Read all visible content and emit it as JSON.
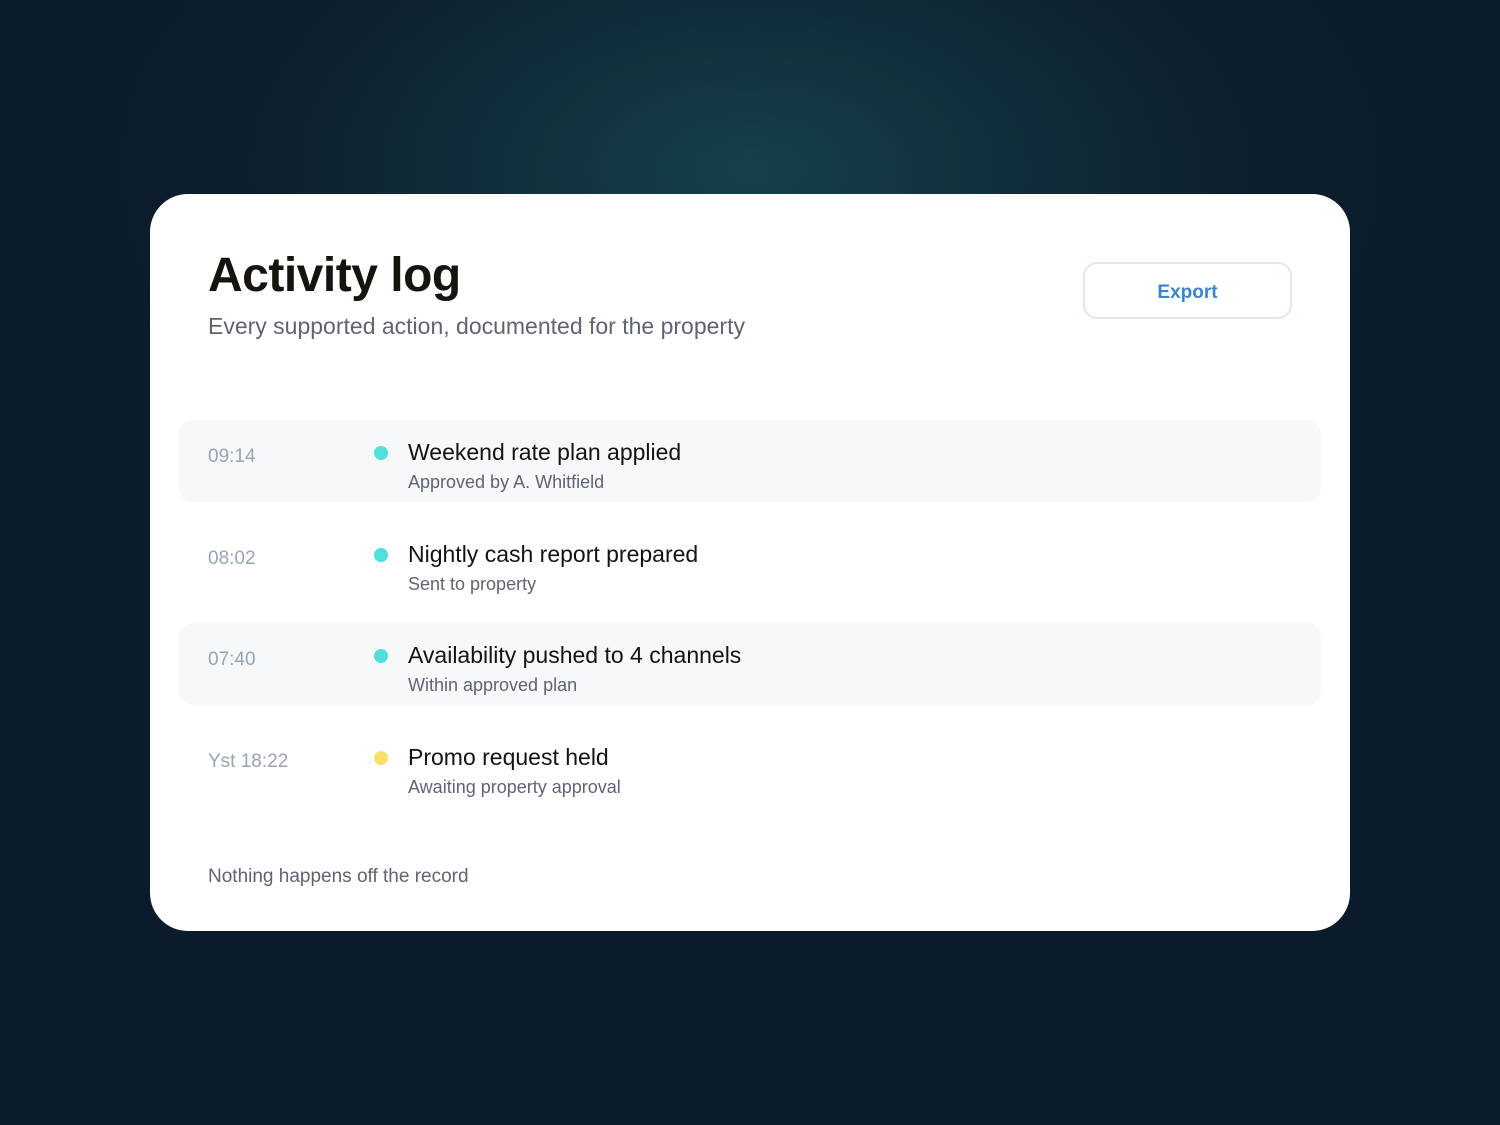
{
  "header": {
    "title": "Activity log",
    "subtitle": "Every supported action, documented for the property",
    "export_label": "Export"
  },
  "entries": [
    {
      "time": "09:14",
      "title": "Weekend rate plan applied",
      "detail": "Approved by A. Whitfield",
      "status_color": "#4fe0dc",
      "shaded": true
    },
    {
      "time": "08:02",
      "title": "Nightly cash report prepared",
      "detail": "Sent to property",
      "status_color": "#4fe0dc",
      "shaded": false
    },
    {
      "time": "07:40",
      "title": "Availability pushed to 4 channels",
      "detail": "Within approved plan",
      "status_color": "#4fe0dc",
      "shaded": true
    },
    {
      "time": "Yst 18:22",
      "title": "Promo request held",
      "detail": "Awaiting property approval",
      "status_color": "#f9e06a",
      "shaded": false
    }
  ],
  "footer": {
    "note": "Nothing happens off the record"
  },
  "colors": {
    "accent": "#3a86c9",
    "status_done": "#4fe0dc",
    "status_pending": "#f9e06a"
  }
}
